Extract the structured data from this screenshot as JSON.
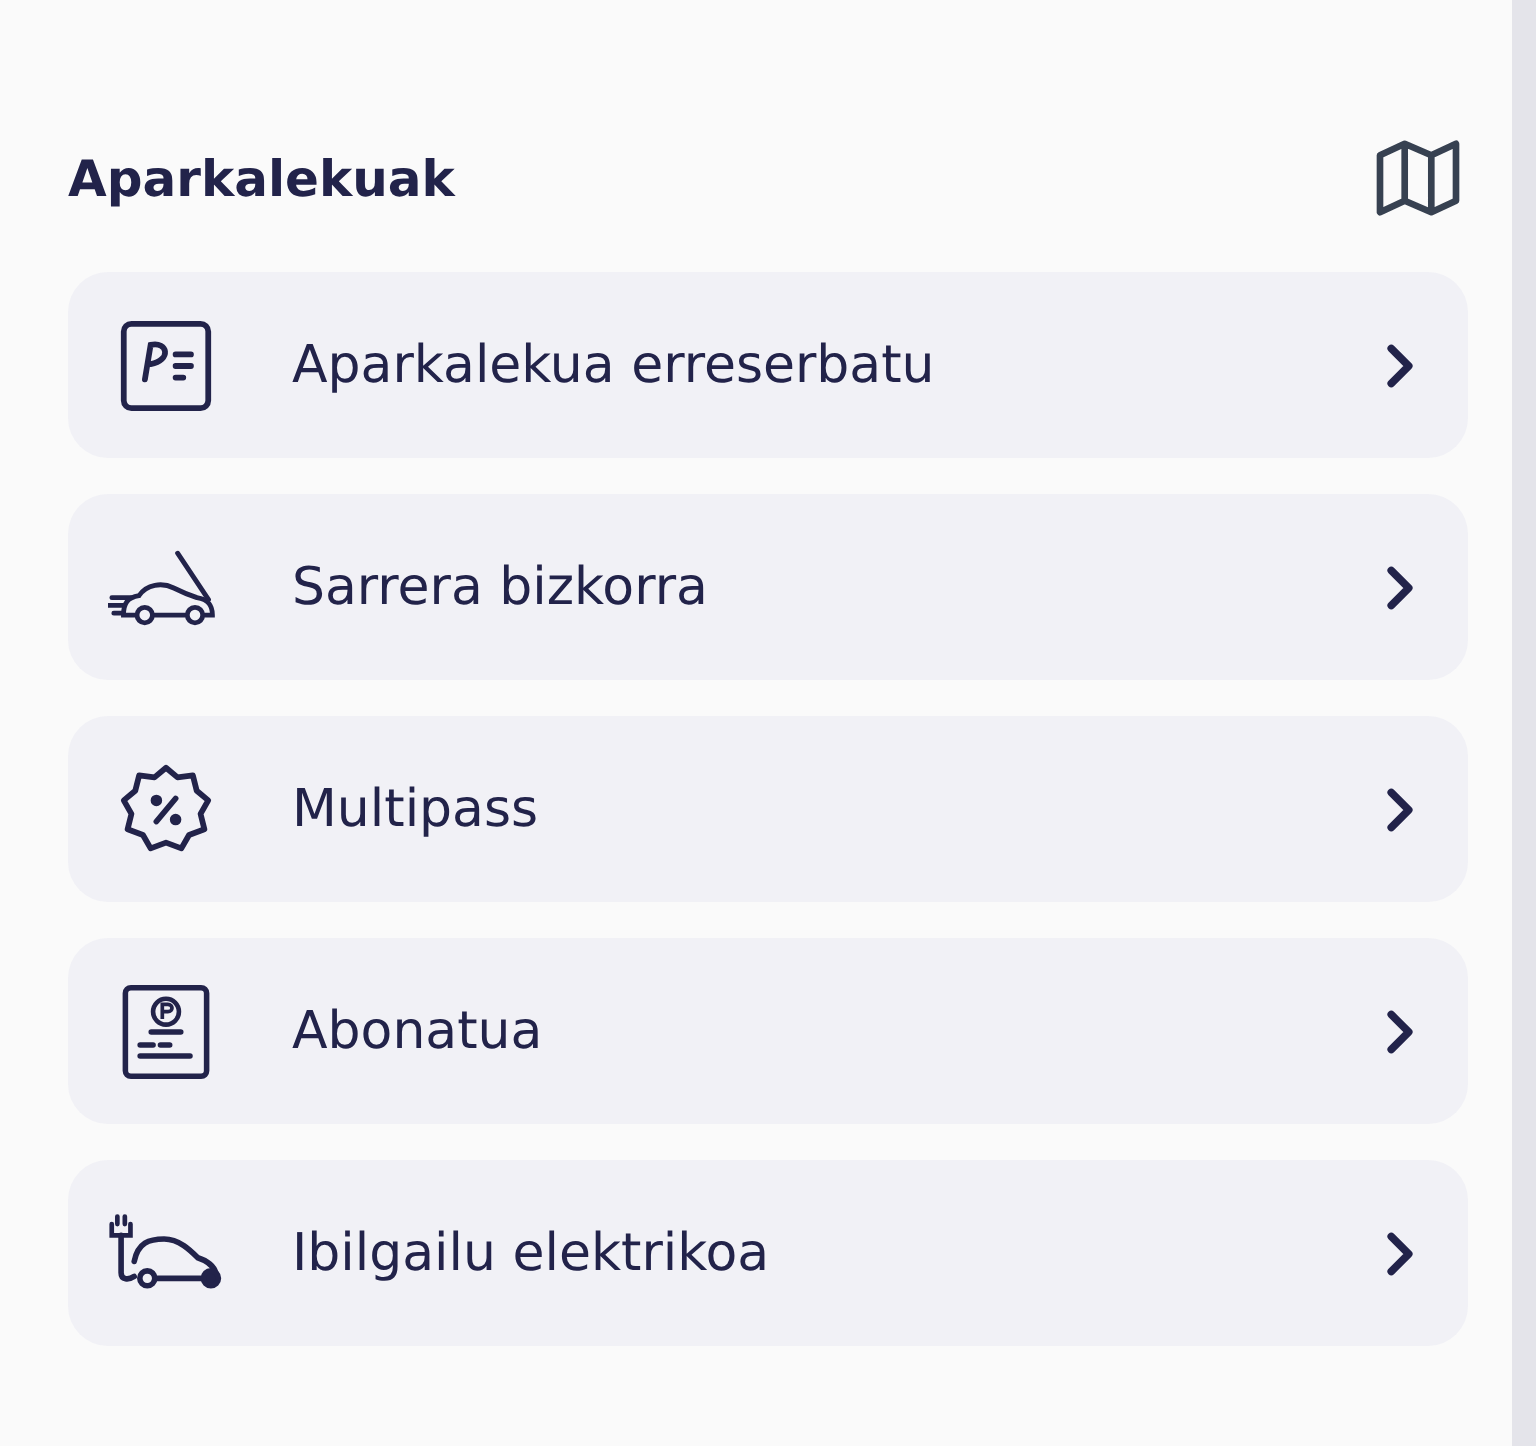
{
  "section": {
    "title": "Aparkalekuak"
  },
  "items": [
    {
      "kind": "reserve",
      "label": "Aparkalekua erreserbatu"
    },
    {
      "kind": "fast-entry",
      "label": "Sarrera bizkorra"
    },
    {
      "kind": "discount",
      "label": "Multipass"
    },
    {
      "kind": "subscription",
      "label": "Abonatua"
    },
    {
      "kind": "electric",
      "label": "Ibilgailu elektrikoa"
    }
  ]
}
